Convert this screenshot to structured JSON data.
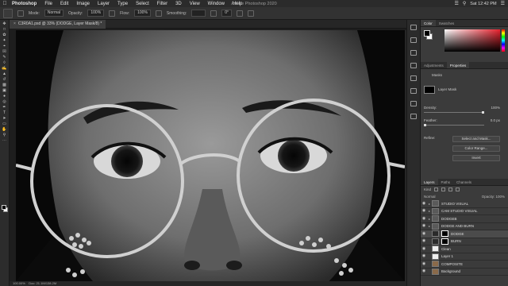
{
  "menubar": {
    "app": "Photoshop",
    "items": [
      "File",
      "Edit",
      "Image",
      "Layer",
      "Type",
      "Select",
      "Filter",
      "3D",
      "View",
      "Window",
      "Help"
    ],
    "center_title": "Adobe Photoshop 2020",
    "clock": "Sat 12:42 PM"
  },
  "options": {
    "mode_label": "Mode:",
    "mode_value": "Normal",
    "opacity_label": "Opacity:",
    "opacity_value": "100%",
    "flow_label": "Flow:",
    "flow_value": "100%",
    "smoothing_label": "Smoothing:",
    "angle_value": "0°"
  },
  "document": {
    "tab_title": "C3R0A1.psd @ 33% (DODGE, Layer Mask/8) *",
    "zoom_status": "100.00%",
    "doc_status": "Doc: 21.1M/138.2M"
  },
  "panels": {
    "color_tabs": [
      "Color",
      "Swatches"
    ],
    "props_tabs": [
      "Adjustments",
      "Properties"
    ],
    "props": {
      "section": "Masks",
      "mask_label": "Layer Mask",
      "density_label": "Density:",
      "density_value": "100%",
      "feather_label": "Feather:",
      "feather_value": "0.0 px",
      "refine_label": "Refine:",
      "btn_select": "Select and Mask...",
      "btn_color_range": "Color Range...",
      "btn_invert": "Invert"
    },
    "layers_tabs": [
      "Layers",
      "Paths",
      "Channels"
    ],
    "layers_kind": "Kind",
    "layers_blend": "Normal",
    "layers_opacity": "Opacity: 100%",
    "layers": [
      {
        "name": "STUDIO VISUAL",
        "thumb": "group",
        "sel": false
      },
      {
        "name": "CAM STUDIO VISUAL",
        "thumb": "group",
        "sel": false
      },
      {
        "name": "DODGEB",
        "thumb": "group",
        "sel": false
      },
      {
        "name": "DODGE AND BURN",
        "thumb": "group",
        "sel": false
      },
      {
        "name": "DODGE",
        "thumb": "mask",
        "sel": true
      },
      {
        "name": "BURN",
        "thumb": "mask",
        "sel": false
      },
      {
        "name": "Clean",
        "thumb": "white",
        "sel": false
      },
      {
        "name": "Layer 1",
        "thumb": "white",
        "sel": false
      },
      {
        "name": "COMPOSITE",
        "thumb": "face",
        "sel": false
      },
      {
        "name": "Background",
        "thumb": "face",
        "sel": false
      }
    ]
  }
}
